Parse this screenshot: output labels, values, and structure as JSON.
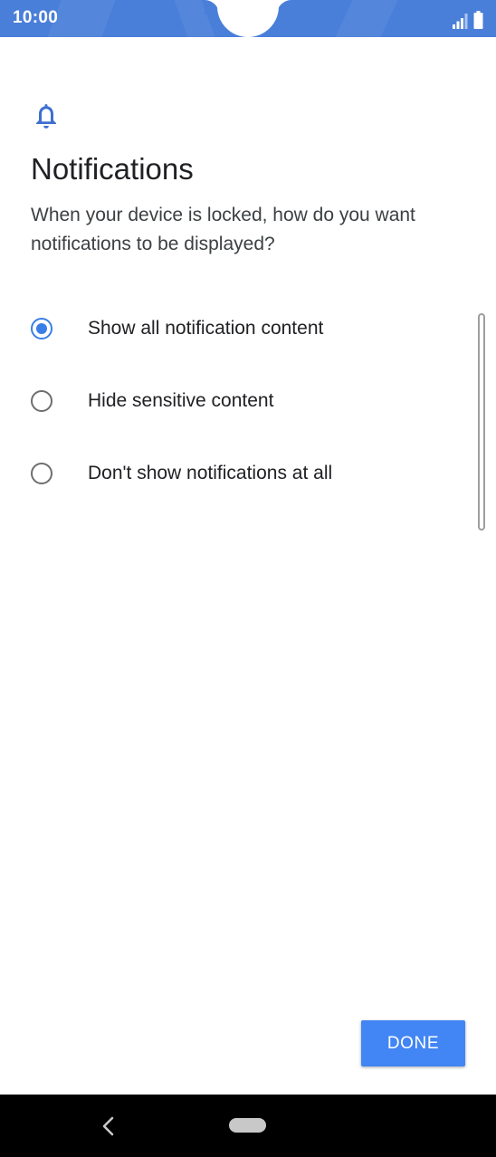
{
  "status_bar": {
    "time": "10:00",
    "background_color": "#4a7fd9",
    "icons": [
      "signal-icon",
      "battery-icon"
    ]
  },
  "header": {
    "icon": "bell-icon",
    "title": "Notifications",
    "subtitle": "When your device is locked, how do you want notifications to be displayed?"
  },
  "options": [
    {
      "label": "Show all notification content",
      "selected": true
    },
    {
      "label": "Hide sensitive content",
      "selected": false
    },
    {
      "label": "Don't show notifications at all",
      "selected": false
    }
  ],
  "actions": {
    "done_label": "DONE",
    "accent_color": "#4285f4"
  },
  "nav_bar": {
    "icons": [
      "back-icon",
      "home-pill-icon"
    ]
  }
}
